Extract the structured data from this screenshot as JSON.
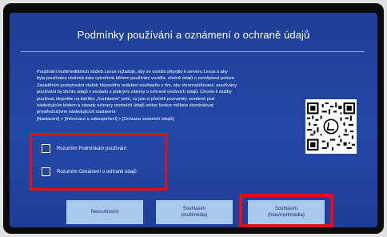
{
  "dialog": {
    "title": "Podmínky používání a oznámení o ochraně údajů",
    "body": "Používání multimediálních služeb Lexus vyžaduje, aby se vozidlo připojilo k serveru Lexus a aby\nbyla používána uložená data vytvořená během používání vozidla, včetně údajů o zeměpisné poloze.\nZaváděním poskytování služeb hlasového ovládání souhlasíte s tím, aby shromažďované, používány\npoužívání by těchto údajů v souladu s platnými zákony o ochraně osobních údajů. Chcete-li služby\npoužívat, klepněte na tlačítko „Souhlasím“ poté, co jste si přečetli poznámky uvedené pod\nnásledujícím kódem a zásady ochrany osobních údajů online funkce měžete zkontrolovat\nprostřednictvím následujících nastavení:\n[Nastavení] > [Informace a zabezpečení] > [Ochrana osobních údajů].",
    "checkboxes": [
      {
        "label": "Rozumím Podmínkám používání",
        "checked": false
      },
      {
        "label": "Rozumím Oznámení o ochraně údajů",
        "checked": false
      }
    ],
    "buttons": {
      "decline": "Nesouhlasím",
      "accept_media_line1": "Souhlasím",
      "accept_media_line2": "(multimédia)",
      "accept_voice_line1": "Souhlasím",
      "accept_voice_line2": "(hlas/multimédia)"
    },
    "qr_logo_icon": "lexus-logo-icon"
  },
  "colors": {
    "screen_bg": "#2448a8",
    "button_bg": "#a9c9ec",
    "highlight": "#e0101b"
  }
}
